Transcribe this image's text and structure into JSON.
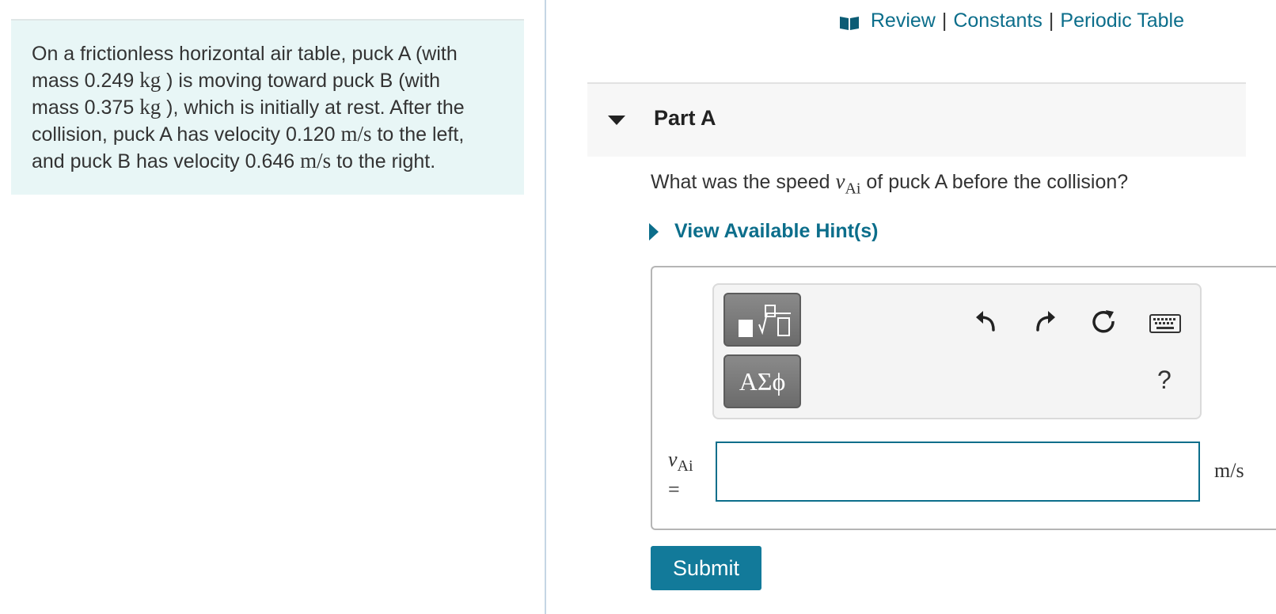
{
  "problem": {
    "l1_pre": "On a frictionless horizontal air table, puck A (with",
    "l2_pre": "mass 0.249 ",
    "l2_unit": "kg",
    "l2_post": " ) is moving toward puck B (with",
    "l3_pre": "mass 0.375 ",
    "l3_unit": "kg",
    "l3_post": " ), which is initially at rest. After the",
    "l4_pre": "collision, puck A has velocity 0.120 ",
    "l4_unit": "m/s",
    "l4_post": " to the left,",
    "l5_pre": "and puck B has velocity 0.646 ",
    "l5_unit": "m/s",
    "l5_post": " to the right."
  },
  "top_links": {
    "review": "Review",
    "constants": "Constants",
    "periodic": "Periodic Table",
    "sep": "|"
  },
  "part": {
    "title": "Part A"
  },
  "question": {
    "pre": "What was the speed ",
    "var": "v",
    "sub": "Ai",
    "post": " of puck A before the collision?"
  },
  "hints": {
    "label": "View Available Hint(s)"
  },
  "toolbar": {
    "greek_label": "ΑΣϕ",
    "help": "?",
    "icons": [
      "templates-icon",
      "undo-icon",
      "redo-icon",
      "reset-icon",
      "keyboard-icon"
    ]
  },
  "answer": {
    "var": "v",
    "sub": "Ai",
    "eq": "=",
    "value": "",
    "unit": "m/s"
  },
  "submit": {
    "label": "Submit"
  },
  "colors": {
    "accent": "#0c6e8b",
    "problem_bg": "#e8f6f6",
    "submit_bg": "#127a9a"
  }
}
